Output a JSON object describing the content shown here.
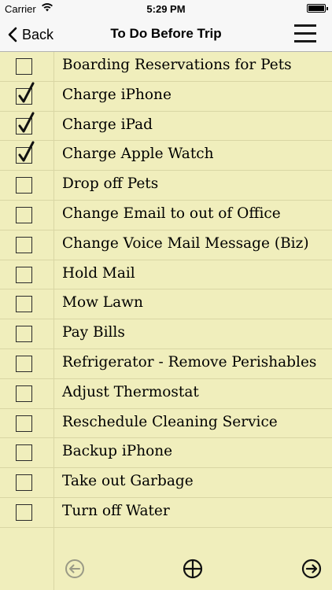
{
  "status": {
    "carrier": "Carrier",
    "time": "5:29 PM"
  },
  "nav": {
    "back_label": "Back",
    "title": "To Do Before Trip"
  },
  "items": [
    {
      "label": "Boarding Reservations for Pets",
      "checked": false
    },
    {
      "label": "Charge iPhone",
      "checked": true
    },
    {
      "label": "Charge iPad",
      "checked": true
    },
    {
      "label": "Charge Apple Watch",
      "checked": true
    },
    {
      "label": "Drop off Pets",
      "checked": false
    },
    {
      "label": "Change Email to out of Office",
      "checked": false
    },
    {
      "label": "Change Voice Mail Message (Biz)",
      "checked": false
    },
    {
      "label": "Hold Mail",
      "checked": false
    },
    {
      "label": "Mow Lawn",
      "checked": false
    },
    {
      "label": "Pay Bills",
      "checked": false
    },
    {
      "label": "Refrigerator - Remove Perishables",
      "checked": false
    },
    {
      "label": "Adjust Thermostat",
      "checked": false
    },
    {
      "label": "Reschedule Cleaning Service",
      "checked": false
    },
    {
      "label": "Backup iPhone",
      "checked": false
    },
    {
      "label": "Take out Garbage",
      "checked": false
    },
    {
      "label": "Turn off Water",
      "checked": false
    }
  ],
  "colors": {
    "paper": "#f0eebc",
    "rule_line": "#d9d6a4",
    "bar": "#f7f7f7"
  },
  "toolbar_icons": [
    "previous-circle-icon",
    "add-circle-icon",
    "next-circle-icon"
  ]
}
